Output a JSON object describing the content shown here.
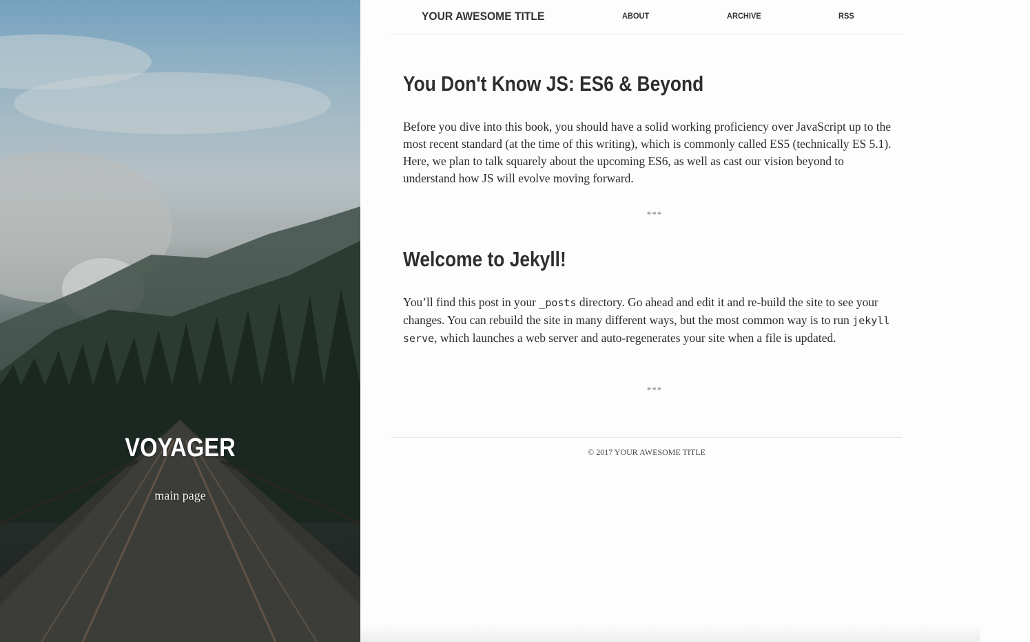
{
  "hero": {
    "title": "VOYAGER",
    "subtitle": "main page"
  },
  "nav": {
    "site_title": "YOUR AWESOME TITLE",
    "links": [
      "ABOUT",
      "ARCHIVE",
      "RSS"
    ]
  },
  "posts": [
    {
      "title": "You Don't Know JS: ES6 & Beyond",
      "body": "Before you dive into this book, you should have a solid working proficiency over JavaScript up to the most recent standard (at the time of this writing), which is commonly called ES5 (technically ES 5.1). Here, we plan to talk squarely about the upcoming ES6, as well as cast our vision beyond to understand how JS will evolve moving forward."
    },
    {
      "title": "Welcome to Jekyll!",
      "body_part1": "You’ll find this post in your ",
      "code1": "_posts",
      "body_part2": " directory. Go ahead and edit it and re-build the site to see your changes. You can rebuild the site in many different ways, but the most common way is to run ",
      "code2": "jekyll serve",
      "body_part3": ", which launches a web server and auto-regenerates your site when a file is updated."
    }
  ],
  "divider": "***",
  "footer": "© 2017 YOUR AWESOME TITLE"
}
